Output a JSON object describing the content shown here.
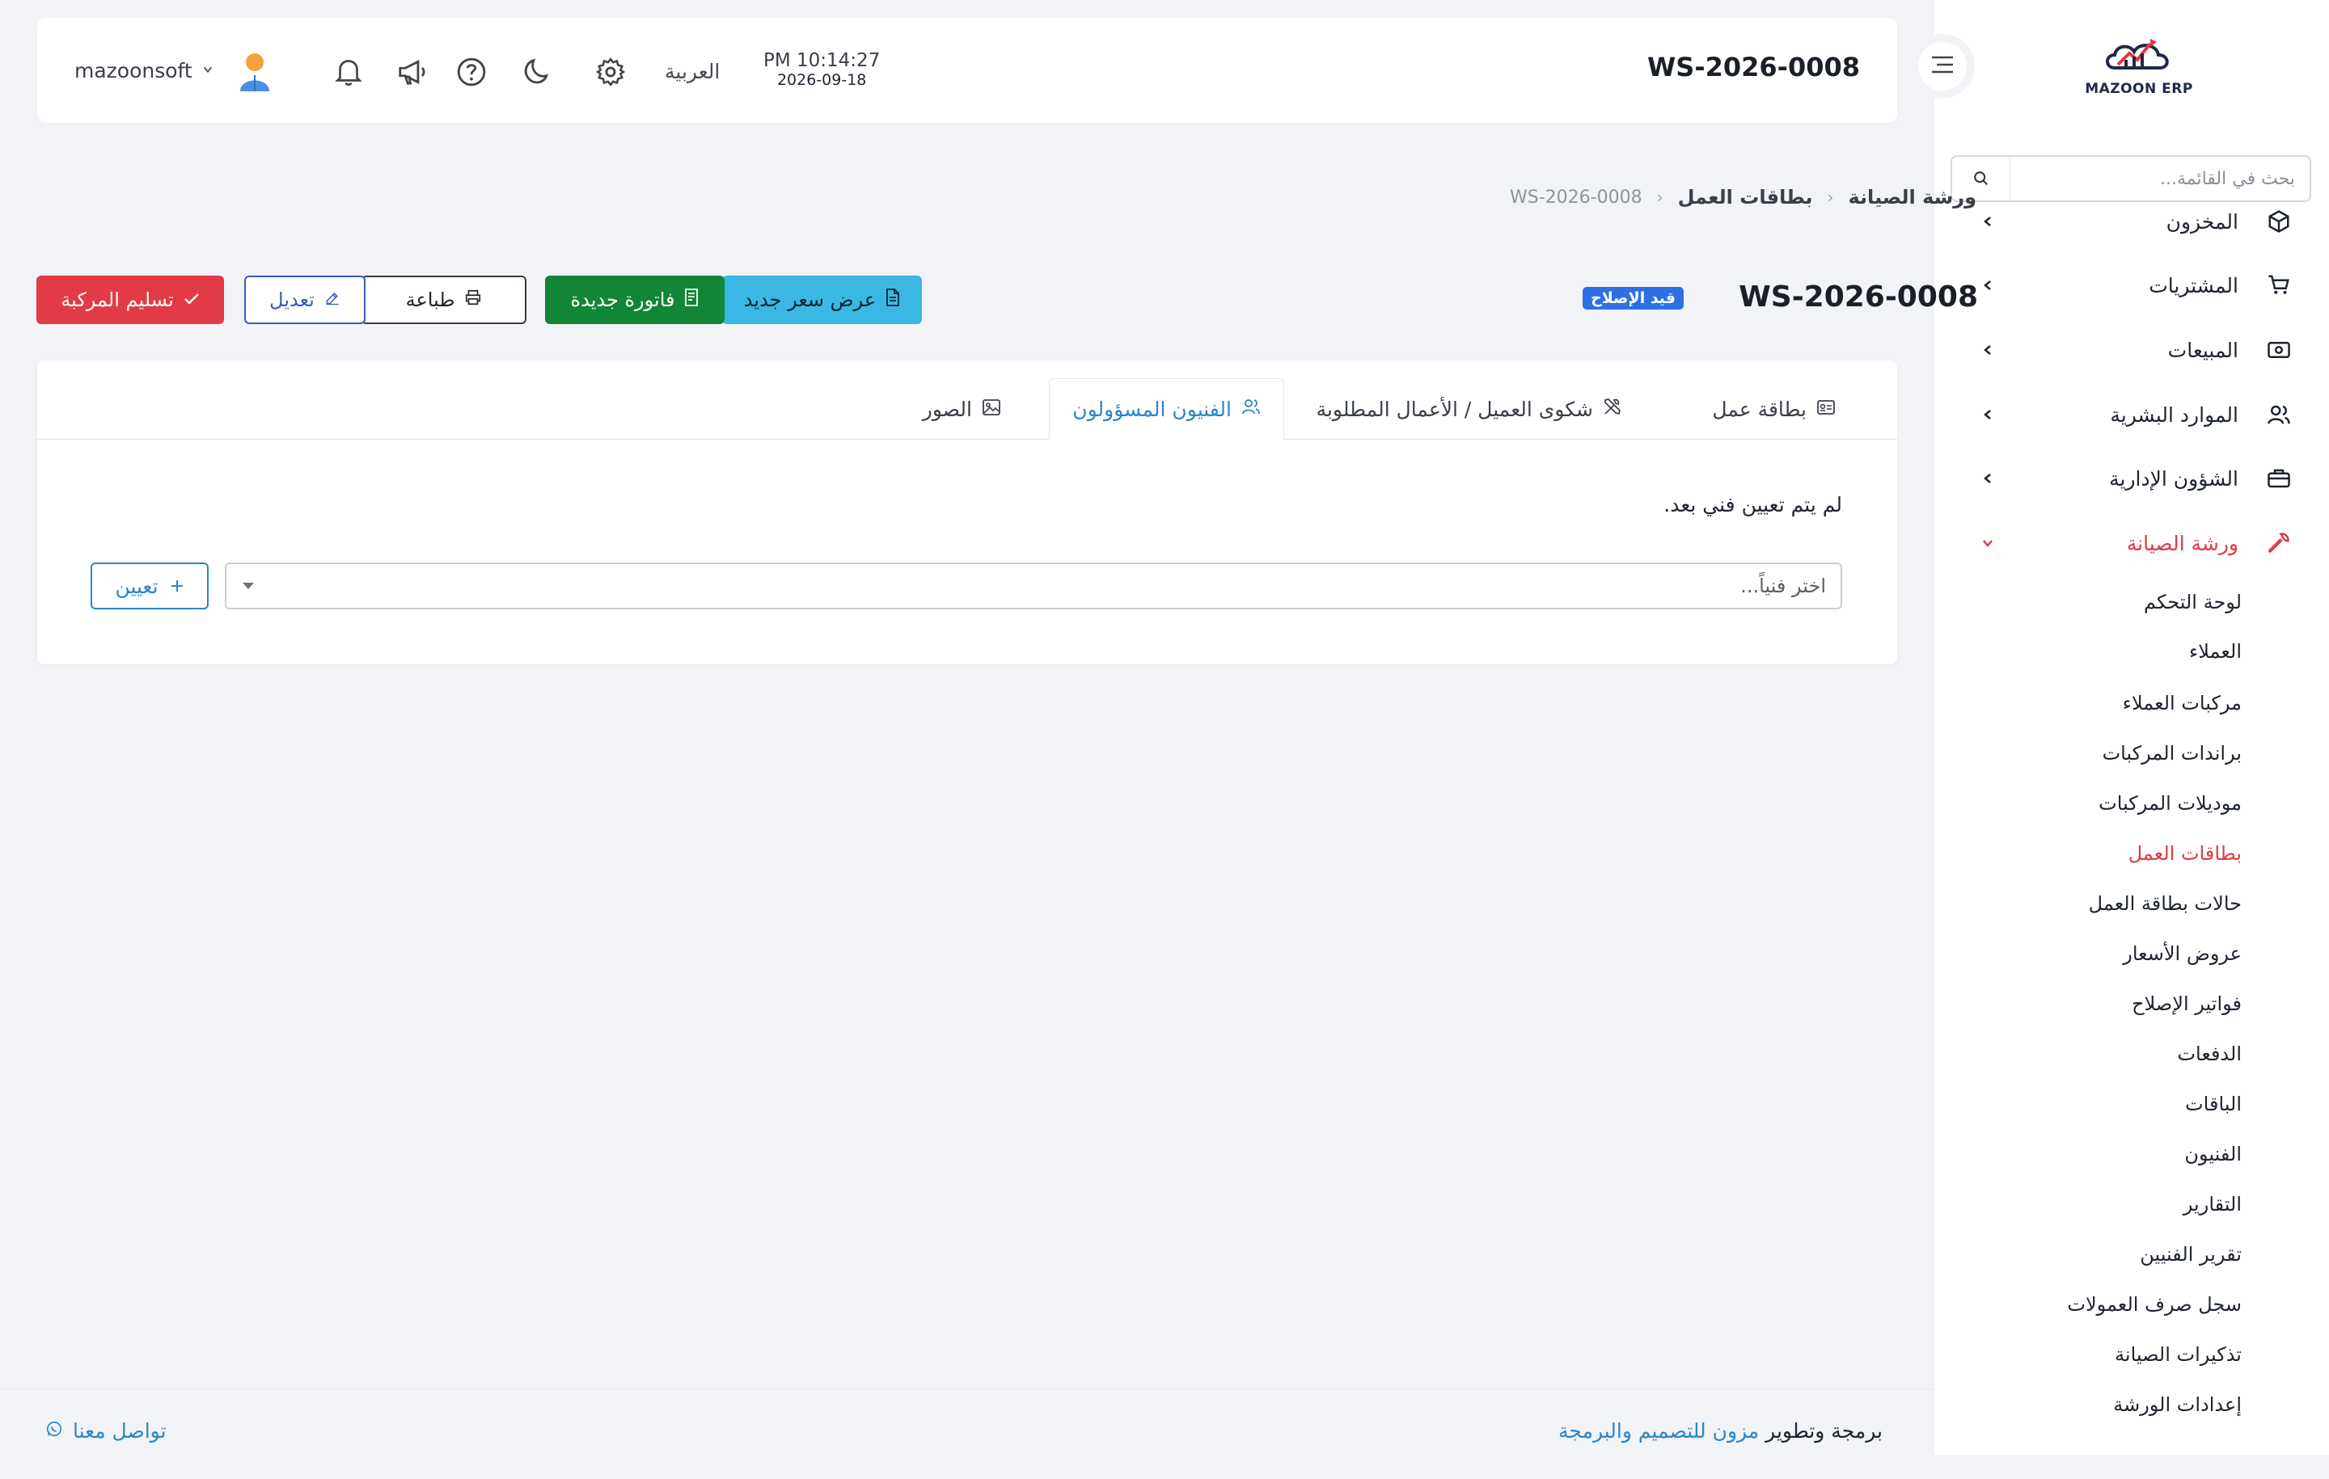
{
  "brand": {
    "name": "MAZOON ERP"
  },
  "header": {
    "title": "WS-2026-0008",
    "time": "PM 10:14:27",
    "date": "2026-09-18",
    "language": "العربية",
    "user_name": "mazoonsoft"
  },
  "sidebar": {
    "search_placeholder": "بحث في القائمة...",
    "items": [
      {
        "label": "المخزون",
        "icon": "box-icon"
      },
      {
        "label": "المشتريات",
        "icon": "cart-icon"
      },
      {
        "label": "المبيعات",
        "icon": "cash-icon"
      },
      {
        "label": "الموارد البشرية",
        "icon": "users-icon"
      },
      {
        "label": "الشؤون الإدارية",
        "icon": "briefcase-icon"
      },
      {
        "label": "ورشة الصيانة",
        "icon": "wrench-icon"
      }
    ],
    "sub_items": [
      "لوحة التحكم",
      "العملاء",
      "مركبات العملاء",
      "براندات المركبات",
      "موديلات المركبات",
      "بطاقات العمل",
      "حالات بطاقة العمل",
      "عروض الأسعار",
      "فواتير الإصلاح",
      "الدفعات",
      "الباقات",
      "الفنيون",
      "التقارير",
      "تقرير الفنيين",
      "سجل صرف العمولات",
      "تذكيرات الصيانة",
      "إعدادات الورشة"
    ],
    "active_sub_index": 5
  },
  "breadcrumb": {
    "root": "ورشة الصيانة",
    "section": "بطاقات العمل",
    "current": "WS-2026-0008"
  },
  "page": {
    "title": "WS-2026-0008",
    "status": "قيد الإصلاح",
    "actions": {
      "new_quote": "عرض سعر جديد",
      "new_invoice": "فاتورة جديدة",
      "print": "طباعة",
      "edit": "تعديل",
      "deliver": "تسليم المركبة"
    }
  },
  "tabs": [
    {
      "label": "بطاقة عمل",
      "icon": "card-icon"
    },
    {
      "label": "شكوى العميل / الأعمال المطلوبة",
      "icon": "tools-icon"
    },
    {
      "label": "الفنيون المسؤولون",
      "icon": "users-icon",
      "active": true
    },
    {
      "label": "الصور",
      "icon": "image-icon"
    }
  ],
  "technicians": {
    "empty_message": "لم يتم تعيين فني بعد.",
    "select_placeholder": "اختر فنياً...",
    "assign_label": "تعيين"
  },
  "footer": {
    "credit_prefix": "برمجة وتطوير",
    "credit_link": "مزون للتصميم والبرمجة",
    "contact": "تواصل معنا"
  },
  "colors": {
    "accent": "#e23a46",
    "link": "#2a86c8",
    "badge": "#2f6fe4",
    "info": "#3bb7e3",
    "success": "#118636"
  }
}
